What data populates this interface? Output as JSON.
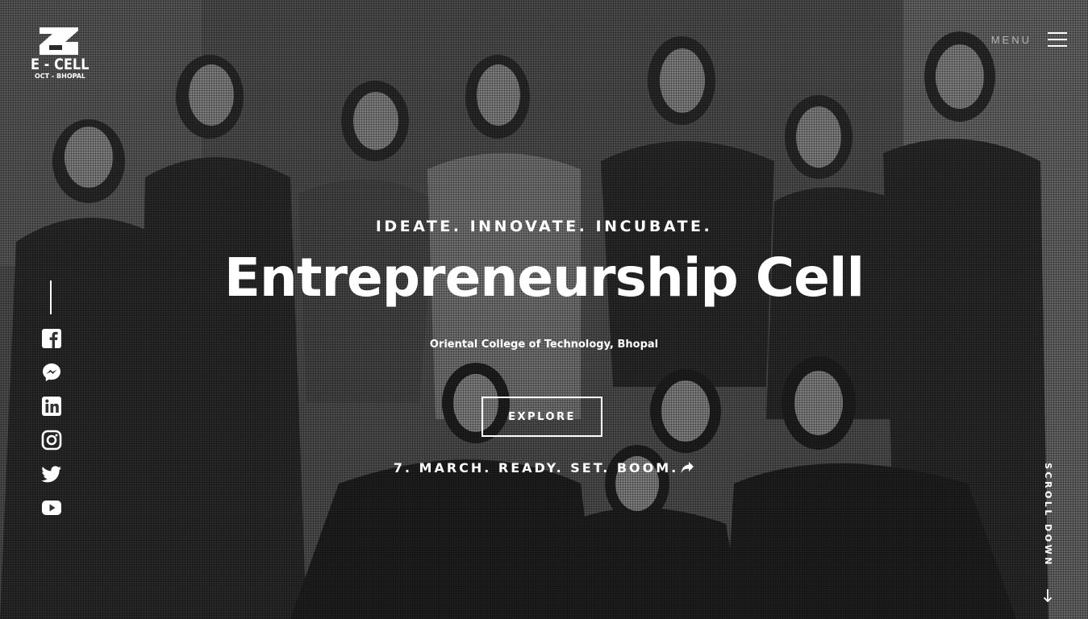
{
  "logo": {
    "name": "E - CELL",
    "subtitle": "OCT - BHOPAL"
  },
  "menu": {
    "label": "MENU"
  },
  "social": [
    {
      "name": "facebook-icon"
    },
    {
      "name": "messenger-icon"
    },
    {
      "name": "linkedin-icon"
    },
    {
      "name": "instagram-icon"
    },
    {
      "name": "twitter-icon"
    },
    {
      "name": "youtube-icon"
    }
  ],
  "hero": {
    "tagline": "IDEATE. INNOVATE. INCUBATE.",
    "title": "Entrepreneurship Cell",
    "subtitle": "Oriental College of Technology, Bhopal",
    "cta_label": "EXPLORE",
    "event_line": "7. MARCH. READY. SET. BOOM."
  },
  "scroll": {
    "label": "SCROLL DOWN"
  },
  "colors": {
    "text": "#ffffff",
    "overlay": "#000000"
  }
}
